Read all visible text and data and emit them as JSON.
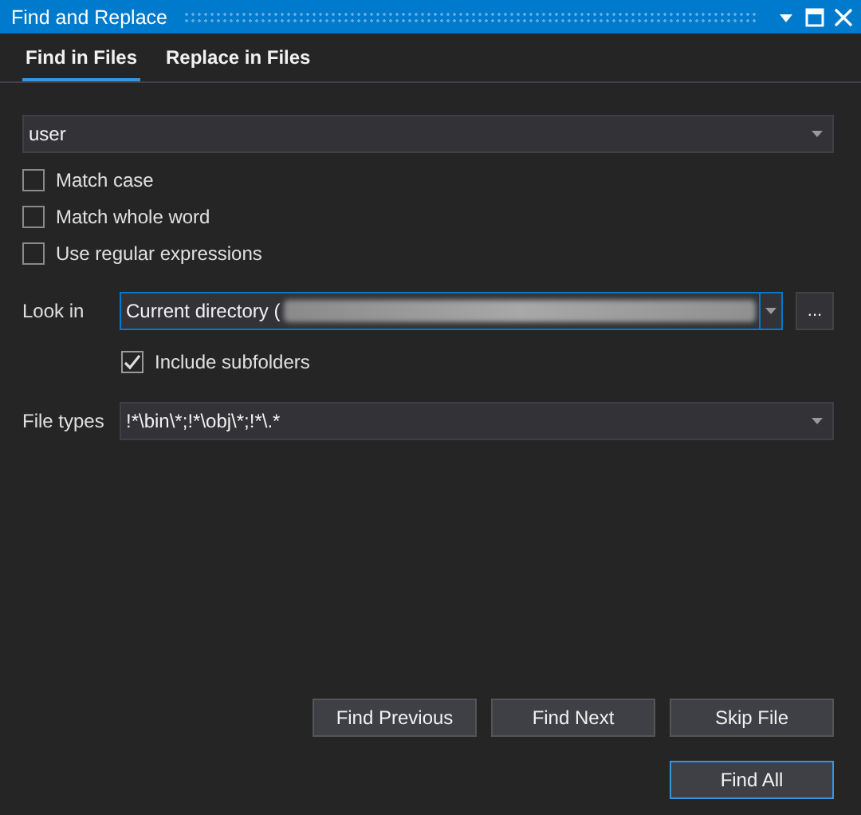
{
  "window": {
    "title": "Find and Replace"
  },
  "tabs": [
    {
      "label": "Find in Files",
      "selected": true
    },
    {
      "label": "Replace in Files",
      "selected": false
    }
  ],
  "search": {
    "value": "user"
  },
  "options": [
    {
      "label": "Match case",
      "checked": false
    },
    {
      "label": "Match whole word",
      "checked": false
    },
    {
      "label": "Use regular expressions",
      "checked": false
    }
  ],
  "look_in": {
    "label": "Look in",
    "value": "Current directory (",
    "browse": "...",
    "include_subfolders": {
      "label": "Include subfolders",
      "checked": true
    }
  },
  "file_types": {
    "label": "File types",
    "value": "!*\\bin\\*;!*\\obj\\*;!*\\.*"
  },
  "buttons": [
    {
      "label": "Find Previous",
      "default": false
    },
    {
      "label": "Find Next",
      "default": false
    },
    {
      "label": "Skip File",
      "default": false
    }
  ],
  "primary_button": {
    "label": "Find All",
    "default": true
  }
}
